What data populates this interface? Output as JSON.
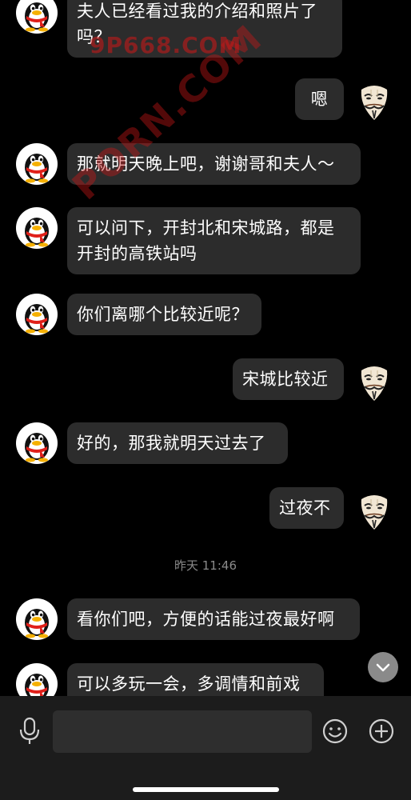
{
  "watermarks": {
    "primary": "9P668.COM",
    "diagonal": "PORN.COM"
  },
  "messages": [
    {
      "side": "left",
      "lines": [
        "夫人已经看过我的介绍和照片了",
        "吗？"
      ],
      "avatar": "qq-penguin"
    },
    {
      "side": "right",
      "text": "嗯",
      "avatar": "guy-fawkes-mask"
    },
    {
      "side": "left",
      "text": "那就明天晚上吧，谢谢哥和夫人～",
      "avatar": "qq-penguin"
    },
    {
      "side": "left",
      "lines": [
        "可以问下，开封北和宋城路，都是",
        "开封的高铁站吗"
      ],
      "avatar": "qq-penguin"
    },
    {
      "side": "left",
      "text": "你们离哪个比较近呢？",
      "avatar": "qq-penguin"
    },
    {
      "side": "right",
      "text": "宋城比较近",
      "avatar": "guy-fawkes-mask"
    },
    {
      "side": "left",
      "text": "好的，那我就明天过去了",
      "avatar": "qq-penguin"
    },
    {
      "side": "right",
      "text": "过夜不",
      "avatar": "guy-fawkes-mask"
    },
    {
      "side": "left",
      "text": "看你们吧，方便的话能过夜最好啊",
      "avatar": "qq-penguin"
    },
    {
      "side": "left",
      "text": "可以多玩一会，多调情和前戏",
      "avatar": "qq-penguin"
    }
  ],
  "timestamp": "昨天 11:46",
  "input_bar": {
    "voice_icon": "microphone-icon",
    "emoji_icon": "smiley-icon",
    "more_icon": "plus-circle-icon",
    "text_value": ""
  },
  "colors": {
    "background": "#000000",
    "bubble": "#2c2c2c",
    "input_bar": "#1c1c1c",
    "watermark": "#d01818"
  }
}
